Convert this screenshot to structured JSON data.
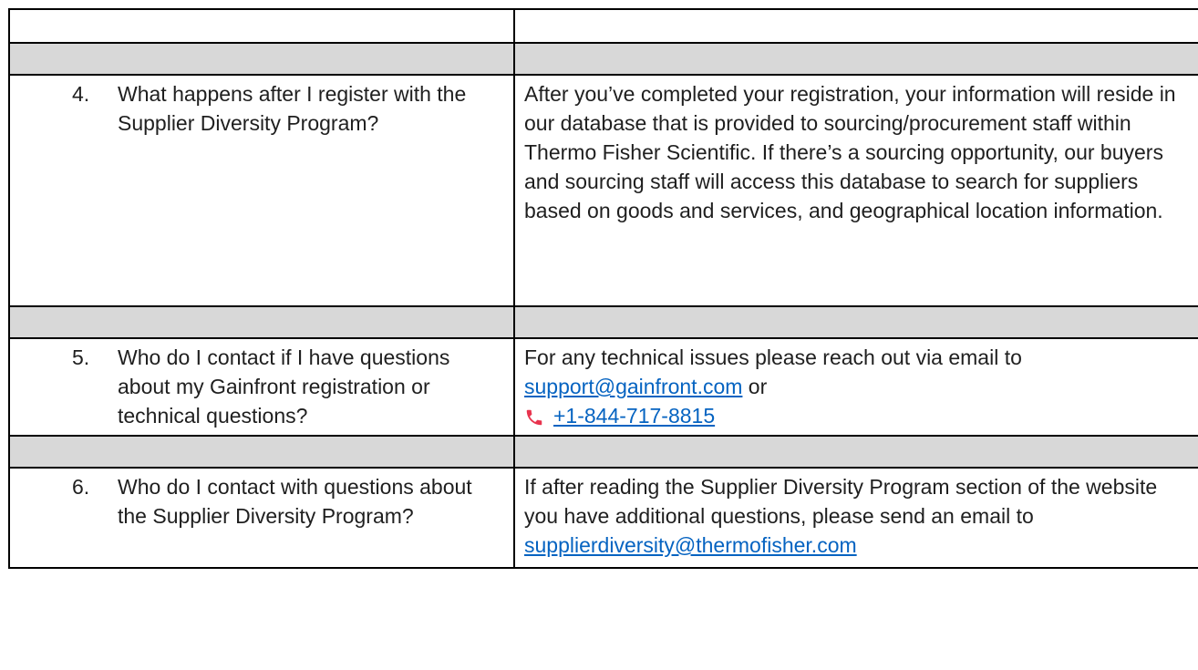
{
  "faq": [
    {
      "number": "4.",
      "question": "What happens after I register with the Supplier Diversity Program?",
      "answer": "After you’ve completed your registration, your information will reside in our database that is provided to sourcing/procurement staff within Thermo Fisher Scientific. If there’s a sourcing opportunity, our buyers and sourcing staff will access this database to search for suppliers based on goods and services, and geographical location information."
    },
    {
      "number": "5.",
      "question": "Who do I contact if I have questions about my Gainfront registration or technical questions?",
      "answer_intro": "For any technical issues please reach out via email to",
      "email": "support@gainfront.com",
      "connector": " or",
      "phone": "+1-844-717-8815",
      "phone_icon": "phone-icon",
      "phone_icon_color": "#e8344e"
    },
    {
      "number": "6.",
      "question": "Who do I contact with questions about the Supplier Diversity Program?",
      "answer_intro": "If after reading the Supplier Diversity Program section of the website you have additional questions, please send an email to",
      "email": "supplierdiversity@thermofisher.com"
    }
  ],
  "link_color": "#0563c1",
  "shade_color": "#d8d8d8"
}
